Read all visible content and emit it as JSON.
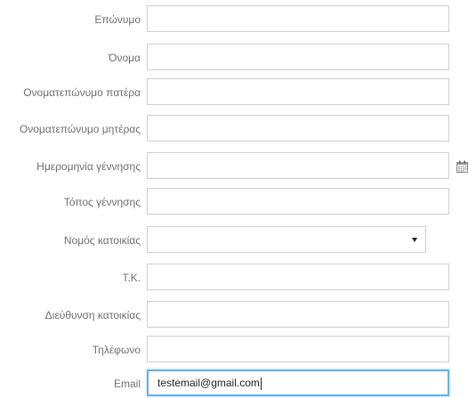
{
  "form": {
    "fields": [
      {
        "label": "Επώνυμο",
        "value": ""
      },
      {
        "label": "Όνομα",
        "value": ""
      },
      {
        "label": "Ονοματεπώνυμο πατέρα",
        "value": ""
      },
      {
        "label": "Ονοματεπώνυμο μητέρας",
        "value": ""
      },
      {
        "label": "Ημερομηνία γέννησης",
        "value": "",
        "icon": "calendar-icon"
      },
      {
        "label": "Τόπος γέννησης",
        "value": ""
      },
      {
        "label": "Νομός κατοικίας",
        "value": "",
        "control": "select"
      },
      {
        "label": "Τ.Κ.",
        "value": ""
      },
      {
        "label": "Διεύθυνση κατοικίας",
        "value": ""
      },
      {
        "label": "Τηλέφωνο",
        "value": ""
      },
      {
        "label": "Email",
        "value": "testemail@gmail.com",
        "focused": true
      }
    ]
  },
  "colors": {
    "focus_border": "#66afe9",
    "field_border": "#cfcfcf",
    "label_text": "#6f6f6f"
  }
}
